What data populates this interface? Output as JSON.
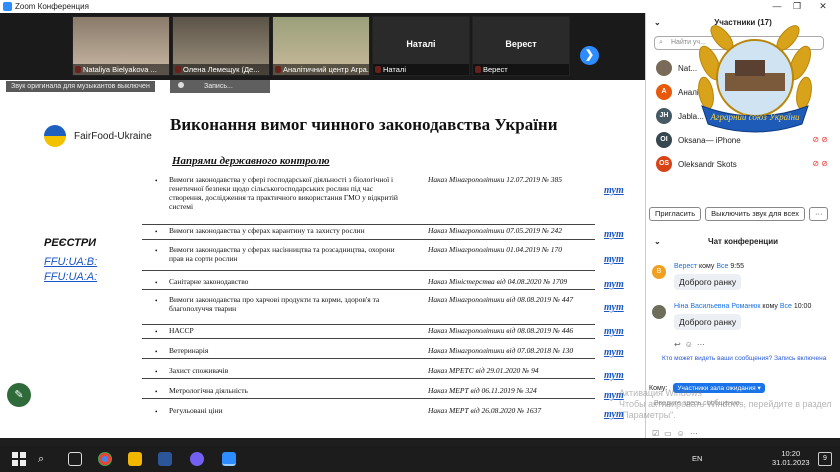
{
  "window": {
    "title": "Zoom Конференция",
    "min": "—",
    "max": "❐",
    "close": "✕"
  },
  "videos": [
    {
      "name": "Nataliya Bielyakova ..."
    },
    {
      "name": "Олена Лемещук (Де..."
    },
    {
      "name": "Аналітичний центр Агра..."
    },
    {
      "big": "Наталі",
      "name": "Наталі"
    },
    {
      "big": "Верест",
      "name": "Верест"
    }
  ],
  "next_button": "❯",
  "status": {
    "sound_off": "Звук оригинала для музыкантов выключен",
    "recording": "Запись..."
  },
  "slide": {
    "logo_text": "FairFood-Ukraine",
    "title": "Виконання вимог чинного законодавства України",
    "subtitle": "Напрями державного контролю",
    "registries_label": "РЕЄСТРИ",
    "registry_links": [
      "FFU:UA:B:",
      "FFU:UA:A:"
    ],
    "link_label": "тут",
    "rows": [
      {
        "text": "Вимоги законодавства у сфері господарської діяльності з біологічної і генетичної безпеки щодо сільськогосподарських рослин під час створення, дослідження та практичного використання ГМО у відкритій системі",
        "doc": "Наказ Мінагрополітики 12.07.2019 № 385"
      },
      {
        "text": "Вимоги законодавства у сферах карантину та захисту рослин",
        "doc": "Наказ Мінагрополітики 07.05.2019 № 242"
      },
      {
        "text": "Вимоги законодавства у сферах насінництва та розсадництва, охорони прав на сорти рослин",
        "doc": "Наказ Мінагрополітики 01.04.2019 № 170"
      },
      {
        "text": "Санітарне законодавство",
        "doc": "Наказ Міністерства від 04.08.2020 № 1709"
      },
      {
        "text": "Вимоги законодавства про харчові продукти та корми, здоров'я та благополуччя тварин",
        "doc": "Наказ Мінагрополітики від 08.08.2019 № 447"
      },
      {
        "text": "НАССР",
        "doc": "Наказ Мінагрополітики від 08.08.2019 № 446"
      },
      {
        "text": "Ветеринарія",
        "doc": "Наказ Мінагрополітики від 07.08.2018 № 130"
      },
      {
        "text": "Захист споживачів",
        "doc": "Наказ МРЕТС від 29.01.2020 № 94"
      },
      {
        "text": "Метрологічна діяльність",
        "doc": "Наказ МЕРТ від 06.11.2019 № 324"
      },
      {
        "text": "Регульовані ціни",
        "doc": "Наказ МЕРТ від 26.08.2020 № 1637"
      }
    ]
  },
  "panel": {
    "participants_title": "Участники (17)",
    "search_placeholder": "Найти уч...",
    "participants": [
      {
        "initial": "",
        "name": "Nat...",
        "color": "#7a6a5a"
      },
      {
        "initial": "A",
        "name": "Аналіт...",
        "color": "#e8590c"
      },
      {
        "initial": "JH",
        "name": "Jabla...",
        "color": "#455a64"
      },
      {
        "initial": "OI",
        "name": "Oksana— iPhone",
        "color": "#37474f"
      },
      {
        "initial": "OS",
        "name": "Oleksandr Skots",
        "color": "#d84315"
      }
    ],
    "invite": "Пригласить",
    "mute_all": "Выключить звук для всех",
    "more": "···",
    "badge_text": "Аграрний союз України"
  },
  "chat": {
    "title": "Чат конференции",
    "messages": [
      {
        "avatar": "B",
        "avatar_color": "#f0a020",
        "sender": "Верест",
        "to_prefix": " кому ",
        "to": "Все",
        "time": "9:55",
        "text": "Доброго ранку"
      },
      {
        "avatar": "",
        "avatar_color": "#6d6d5a",
        "sender": "Ніна Васильевна Романюк",
        "to_prefix": " кому ",
        "to": "Все",
        "time": "10:00",
        "text": "Доброго ранку"
      }
    ],
    "who_can_see": "Кто может видеть ваши сообщения? Запись включена",
    "to_label": "Кому:",
    "to_value": "Участники зала ожидания ▾",
    "input_placeholder": "Введите здесь сообщение..."
  },
  "watermark": "Активация Windows\nЧтобы активировать Windows, перейдите в раздел \"Параметры\".",
  "taskbar": {
    "lang": "EN",
    "time": "10:20",
    "date": "31.01.2023",
    "notif": "9"
  }
}
